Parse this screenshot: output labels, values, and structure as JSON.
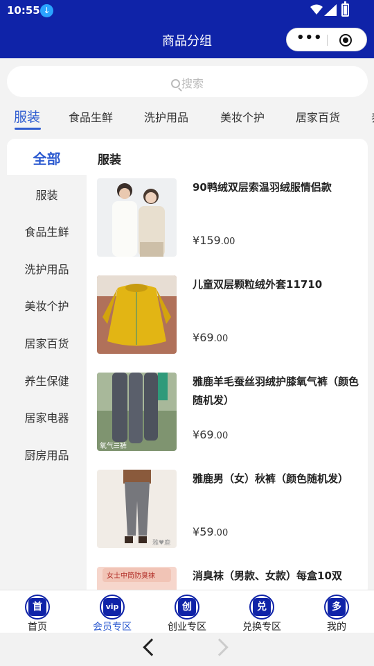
{
  "status_bar": {
    "time": "10:55"
  },
  "nav": {
    "title": "商品分组",
    "more_glyph": "•••"
  },
  "search": {
    "placeholder": "搜索"
  },
  "top_tabs": [
    "服装",
    "食品生鲜",
    "洗护用品",
    "美妆个护",
    "居家百货",
    "养"
  ],
  "sidebar": {
    "all_label": "全部",
    "items": [
      "服装",
      "食品生鲜",
      "洗护用品",
      "美妆个护",
      "居家百货",
      "养生保健",
      "居家电器",
      "厨房用品"
    ]
  },
  "section_title": "服装",
  "products": [
    {
      "name": "90鸭绒双层索温羽绒服情侣款",
      "currency": "¥",
      "price_int": "159",
      "price_dec": ".00",
      "image_icon": "couple-jackets-photo"
    },
    {
      "name": "儿童双层颗粒绒外套11710",
      "currency": "¥",
      "price_int": "69",
      "price_dec": ".00",
      "image_icon": "yellow-kids-jacket-photo"
    },
    {
      "name": "雅鹿羊毛蚕丝羽绒护膝氧气裤（颜色随机发）",
      "currency": "¥",
      "price_int": "69",
      "price_dec": ".00",
      "image_icon": "leggings-photo",
      "image_caption": "氧气☰裤"
    },
    {
      "name": "雅鹿男（女）秋裤（颜色随机发）",
      "currency": "¥",
      "price_int": "59",
      "price_dec": ".00",
      "image_icon": "thermal-pants-photo",
      "image_caption": "雅♥鹿"
    },
    {
      "name": "消臭袜（男款、女款）每盒10双",
      "image_icon": "socks-box-photo",
      "image_caption": "女士中筒防臭袜"
    }
  ],
  "tabbar": [
    {
      "glyph": "首",
      "label": "首页"
    },
    {
      "glyph": "vip",
      "label": "会员专区"
    },
    {
      "glyph": "创",
      "label": "创业专区"
    },
    {
      "glyph": "兑",
      "label": "兑换专区"
    },
    {
      "glyph": "多",
      "label": "我的"
    }
  ],
  "colors": {
    "brand": "#0f23a8",
    "accent": "#2d5bd0",
    "background": "#f3f3f3"
  }
}
